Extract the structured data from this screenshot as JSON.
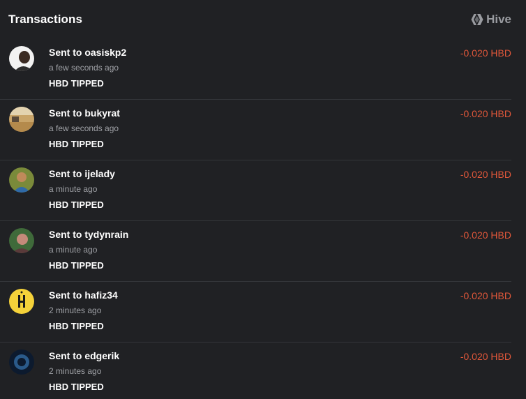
{
  "header": {
    "title": "Transactions",
    "brand": "Hive",
    "brand_icon": "hive-logo-icon"
  },
  "colors": {
    "background": "#202124",
    "amount_negative": "#e0573a",
    "muted": "#9fa1a6"
  },
  "transactions": [
    {
      "prefix": "Sent to",
      "user": "oasiskp2",
      "time": "a few seconds ago",
      "memo": "HBD TIPPED",
      "amount": "-0.020 HBD",
      "avatar": "avatar-oasiskp2"
    },
    {
      "prefix": "Sent to",
      "user": "bukyrat",
      "time": "a few seconds ago",
      "memo": "HBD TIPPED",
      "amount": "-0.020 HBD",
      "avatar": "avatar-bukyrat"
    },
    {
      "prefix": "Sent to",
      "user": "ijelady",
      "time": "a minute ago",
      "memo": "HBD TIPPED",
      "amount": "-0.020 HBD",
      "avatar": "avatar-ijelady"
    },
    {
      "prefix": "Sent to",
      "user": "tydynrain",
      "time": "a minute ago",
      "memo": "HBD TIPPED",
      "amount": "-0.020 HBD",
      "avatar": "avatar-tydynrain"
    },
    {
      "prefix": "Sent to",
      "user": "hafiz34",
      "time": "2 minutes ago",
      "memo": "HBD TIPPED",
      "amount": "-0.020 HBD",
      "avatar": "avatar-hafiz34"
    },
    {
      "prefix": "Sent to",
      "user": "edgerik",
      "time": "2 minutes ago",
      "memo": "HBD TIPPED",
      "amount": "-0.020 HBD",
      "avatar": "avatar-edgerik"
    }
  ]
}
